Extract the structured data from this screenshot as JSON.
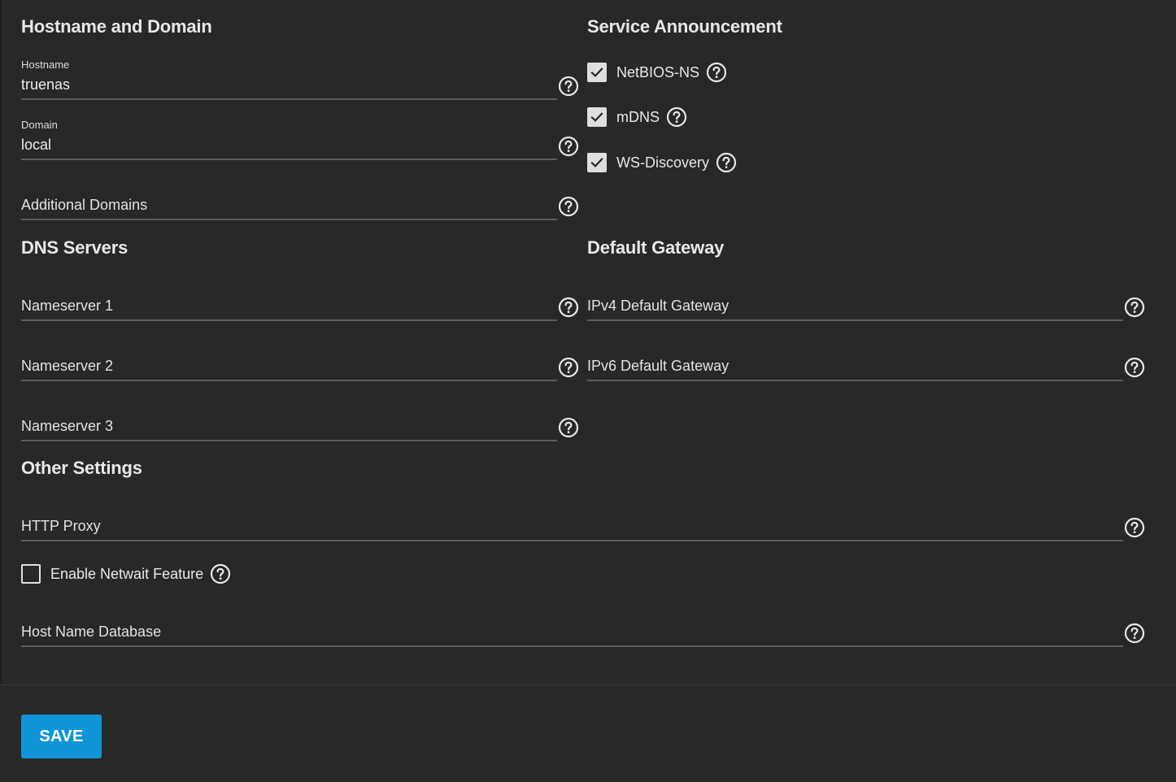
{
  "sections": {
    "hostname_domain": "Hostname and Domain",
    "service_announcement": "Service Announcement",
    "dns_servers": "DNS Servers",
    "default_gateway": "Default Gateway",
    "other_settings": "Other Settings"
  },
  "fields": {
    "hostname": {
      "label": "Hostname",
      "value": "truenas"
    },
    "domain": {
      "label": "Domain",
      "value": "local"
    },
    "additional_domains": {
      "placeholder": "Additional Domains"
    },
    "nameserver1": {
      "placeholder": "Nameserver 1"
    },
    "nameserver2": {
      "placeholder": "Nameserver 2"
    },
    "nameserver3": {
      "placeholder": "Nameserver 3"
    },
    "ipv4_gateway": {
      "placeholder": "IPv4 Default Gateway"
    },
    "ipv6_gateway": {
      "placeholder": "IPv6 Default Gateway"
    },
    "http_proxy": {
      "placeholder": "HTTP Proxy"
    },
    "host_name_database": {
      "placeholder": "Host Name Database"
    }
  },
  "checkboxes": {
    "netbios_ns": {
      "label": "NetBIOS-NS",
      "checked": true
    },
    "mdns": {
      "label": "mDNS",
      "checked": true
    },
    "ws_discovery": {
      "label": "WS-Discovery",
      "checked": true
    },
    "netwait": {
      "label": "Enable Netwait Feature",
      "checked": false
    }
  },
  "icons": {
    "help": "help-circle-icon",
    "check": "checkmark-icon"
  },
  "actions": {
    "save_label": "SAVE"
  },
  "colors": {
    "background": "#282828",
    "accent": "#0f95d8",
    "underline": "#5c5c5c"
  }
}
